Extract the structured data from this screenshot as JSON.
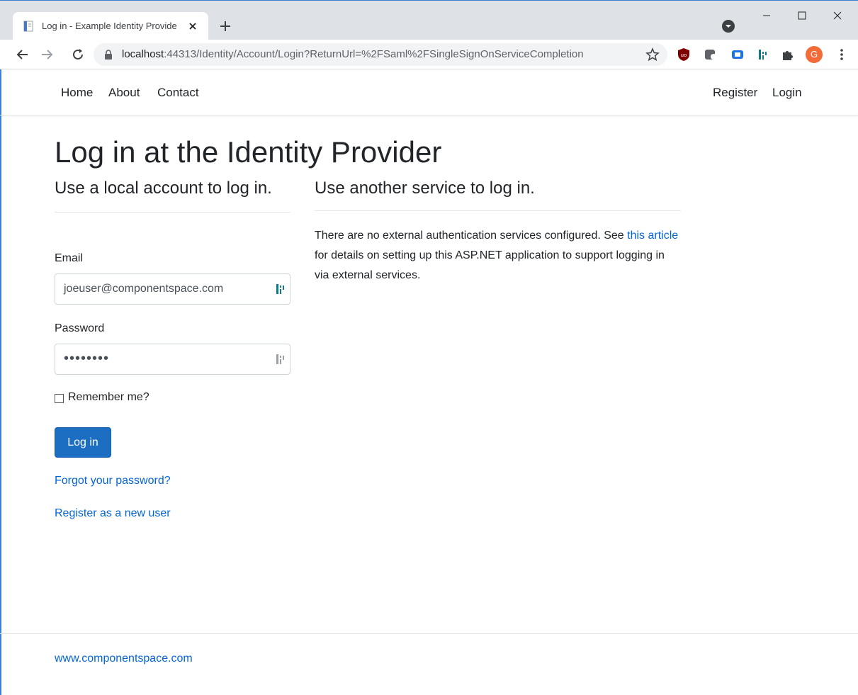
{
  "browser": {
    "tab": {
      "title": "Log in - Example Identity Provide",
      "close_label": "×"
    },
    "address": {
      "host": "localhost",
      "rest": ":44313/Identity/Account/Login?ReturnUrl=%2FSaml%2FSingleSignOnServiceCompletion"
    },
    "avatar_initial": "G"
  },
  "nav": {
    "left": [
      "Home",
      "About",
      "Contact"
    ],
    "right": [
      "Register",
      "Login"
    ]
  },
  "page": {
    "title": "Log in at the Identity Provider"
  },
  "local": {
    "heading": "Use a local account to log in.",
    "email_label": "Email",
    "email_value": "joeuser@componentspace.com",
    "password_label": "Password",
    "password_value": "••••••••",
    "remember_label": "Remember me?",
    "login_button": "Log in",
    "forgot_link": "Forgot your password?",
    "register_link": "Register as a new user"
  },
  "external": {
    "heading": "Use another service to log in.",
    "text_before": "There are no external authentication services configured. See ",
    "link_text": "this article",
    "text_after": " for details on setting up this ASP.NET application to support logging in via external services."
  },
  "footer": {
    "link": "www.componentspace.com"
  },
  "colors": {
    "accent_button": "#1b6ec2",
    "link": "#0366d6",
    "avatar": "#f26b38"
  }
}
